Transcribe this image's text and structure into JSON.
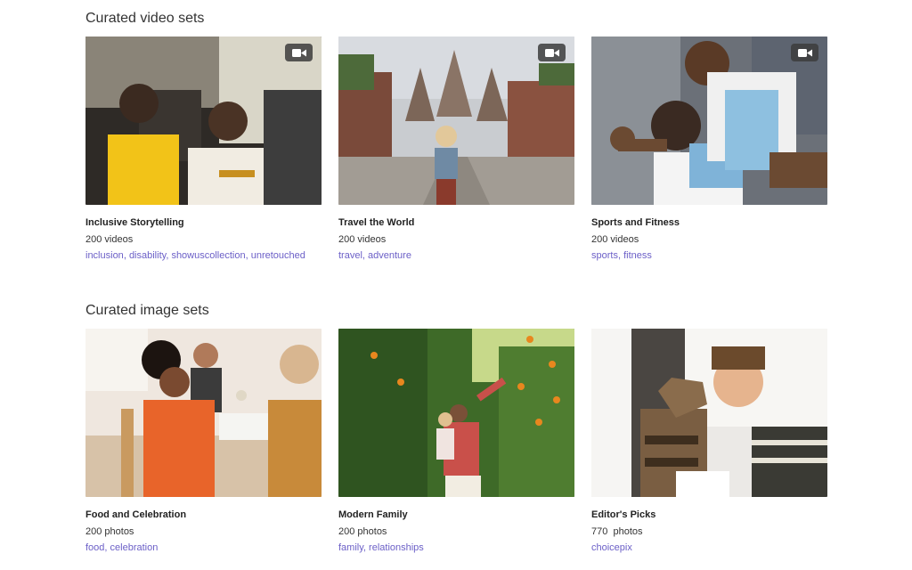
{
  "video_section": {
    "title": "Curated video sets",
    "cards": [
      {
        "title": "Inclusive Storytelling",
        "count": "200 videos",
        "tags": [
          "inclusion",
          "disability",
          "showuscollection",
          "unretouched"
        ],
        "icon": "video-camera-icon"
      },
      {
        "title": "Travel the World",
        "count": "200 videos",
        "tags": [
          "travel",
          "adventure"
        ],
        "icon": "video-camera-icon"
      },
      {
        "title": "Sports and Fitness",
        "count": "200 videos",
        "tags": [
          "sports",
          "fitness"
        ],
        "icon": "video-camera-icon"
      }
    ]
  },
  "image_section": {
    "title": "Curated image sets",
    "cards": [
      {
        "title": "Food and Celebration",
        "count": "200 photos",
        "tags": [
          "food",
          "celebration"
        ]
      },
      {
        "title": "Modern Family",
        "count": "200 photos",
        "tags": [
          "family",
          "relationships"
        ]
      },
      {
        "title": "Editor's Picks",
        "count": "770  photos",
        "tags": [
          "choicepix"
        ]
      }
    ]
  },
  "colors": {
    "tag": "#6b5fc7",
    "badge": "#3c3c3c"
  }
}
